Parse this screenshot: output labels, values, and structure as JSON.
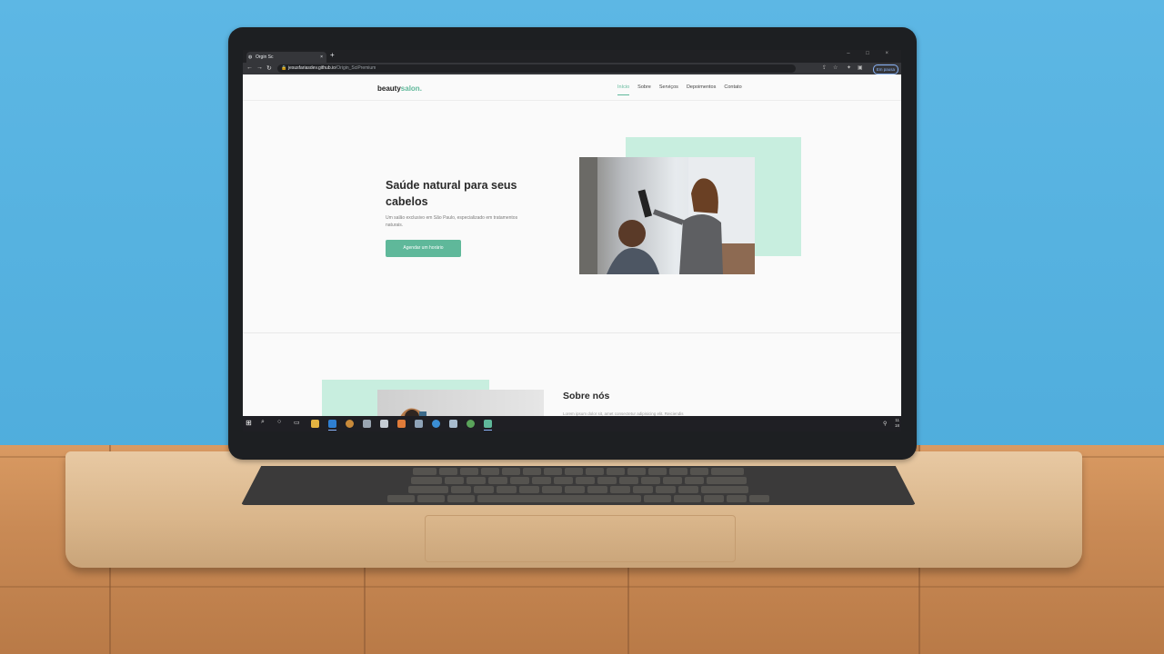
{
  "browser": {
    "tab_title": "Orgin Sc",
    "tab_close": "×",
    "new_tab": "+",
    "window_controls": "– □ ×",
    "url_host": "jesusfariasdev.github.io",
    "url_path": "/Origin_SciPremium",
    "profile_label": "Em pausa"
  },
  "site": {
    "logo_main": "beauty",
    "logo_accent": "salon.",
    "nav": [
      "Início",
      "Sobre",
      "Serviços",
      "Depoimentos",
      "Contato"
    ],
    "hero": {
      "title": "Saúde natural para seus cabelos",
      "subtitle": "Um salão exclusivo em São Paulo, especializado em tratamentos naturais.",
      "cta": "Agendar um horário"
    },
    "about": {
      "title": "Sobre nós",
      "text": "Lorem ipsum dolor sit, amet consectetur adipisicing elit. Reiciendis"
    }
  },
  "taskbar": {
    "clock_time": "11",
    "clock_date": "18"
  },
  "colors": {
    "accent": "#5fb89a",
    "accent_light": "#c8eedf",
    "background": "#4aa9d9"
  }
}
